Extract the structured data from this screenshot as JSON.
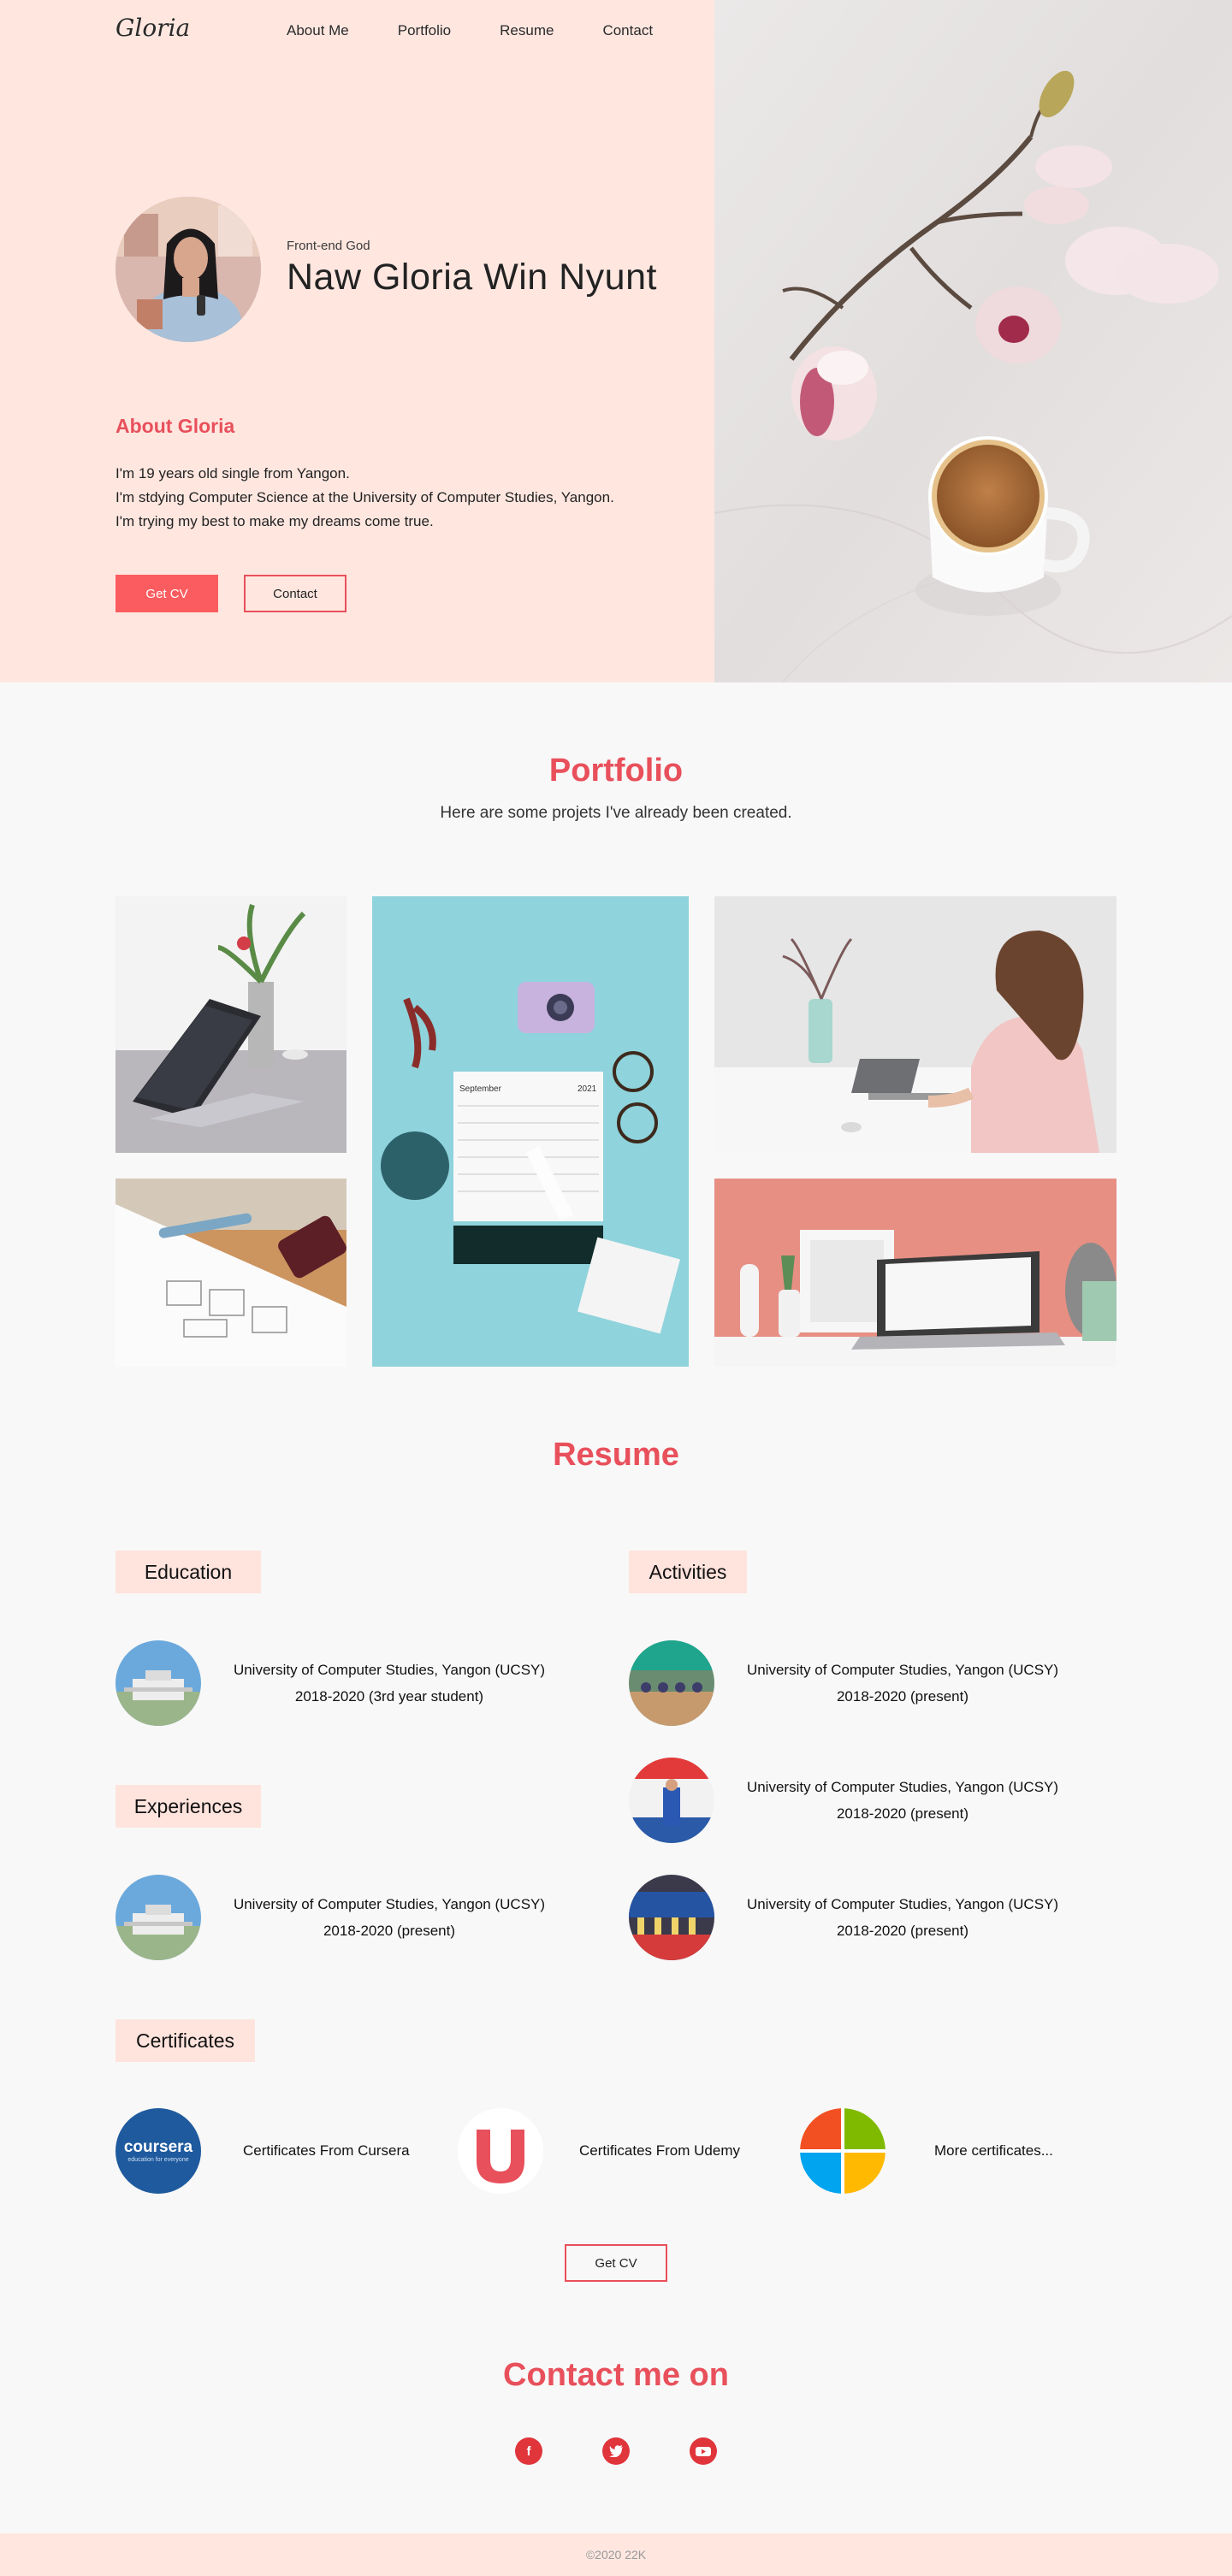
{
  "header": {
    "logo": "Gloria",
    "nav": [
      "About Me",
      "Portfolio",
      "Resume",
      "Contact"
    ]
  },
  "hero": {
    "tagline": "Front-end God",
    "name": "Naw Gloria Win Nyunt",
    "about_title": "About Gloria",
    "about_lines": [
      "I'm 19 years old single from Yangon.",
      "I'm stdying Computer Science at the University of Computer Studies, Yangon.",
      "I'm trying my best to make my dreams come true."
    ],
    "btn_cv": "Get CV",
    "btn_contact": "Contact"
  },
  "portfolio": {
    "title": "Portfolio",
    "subtitle": "Here are some projets I've already been created."
  },
  "resume": {
    "title": "Resume",
    "education": {
      "heading": "Education",
      "items": [
        {
          "line1": "University of Computer Studies, Yangon (UCSY)",
          "line2": "2018-2020 (3rd year student)"
        }
      ]
    },
    "experiences": {
      "heading": "Experiences",
      "items": [
        {
          "line1": "University of Computer Studies, Yangon (UCSY)",
          "line2": "2018-2020 (present)"
        }
      ]
    },
    "activities": {
      "heading": "Activities",
      "items": [
        {
          "line1": "University of Computer Studies, Yangon (UCSY)",
          "line2": "2018-2020 (present)"
        },
        {
          "line1": "University of Computer Studies, Yangon (UCSY)",
          "line2": "2018-2020 (present)"
        },
        {
          "line1": "University of Computer Studies, Yangon (UCSY)",
          "line2": "2018-2020 (present)"
        }
      ]
    },
    "certificates": {
      "heading": "Certificates",
      "coursera_logo": "coursera",
      "coursera_tag": "education for everyone",
      "items": [
        "Certificates From Cursera",
        "Certificates From Udemy",
        "More certificates..."
      ]
    },
    "btn_cv": "Get CV"
  },
  "contact": {
    "title": "Contact me on",
    "icons": [
      "facebook-icon",
      "twitter-icon",
      "youtube-icon"
    ]
  },
  "footer": {
    "text": "©2020 22K"
  },
  "colors": {
    "accent": "#e8505b",
    "hero_bg": "#ffe7e0",
    "page_bg": "#f8f8f8"
  }
}
